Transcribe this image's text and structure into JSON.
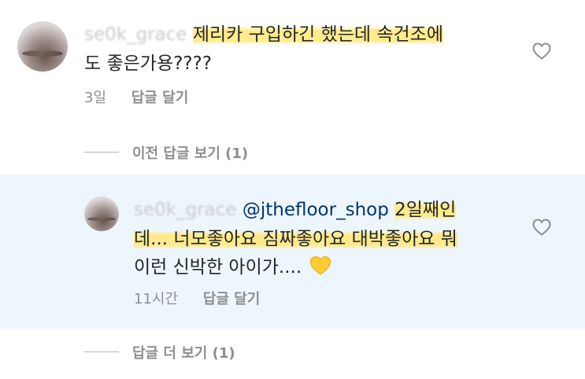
{
  "comment1": {
    "username": "se0k_grace",
    "text_line1": "제리카 구입하긴 했는데 속건조에",
    "text_line2": "도 좋은가용????",
    "time": "3일",
    "reply_label": "답글 달기"
  },
  "view_previous": {
    "label": "이전 답글 보기 (1)"
  },
  "comment2": {
    "username": "se0k_grace",
    "mention": "@jthefloor_shop",
    "text_line1_rest": "2일째인",
    "text_line2": "데... 너모좋아요 짐짜좋아요 대박좋아요 뭐",
    "text_line3": "이런 신박한 아이가....",
    "emoji": "yellow-heart",
    "time": "11시간",
    "reply_label": "답글 달기"
  },
  "view_more": {
    "label": "답글 더 보기 (1)"
  },
  "colors": {
    "highlight": "#ffe878",
    "reply_background": "#eef6fd",
    "mention": "#003569",
    "muted": "#8e8e8e"
  }
}
